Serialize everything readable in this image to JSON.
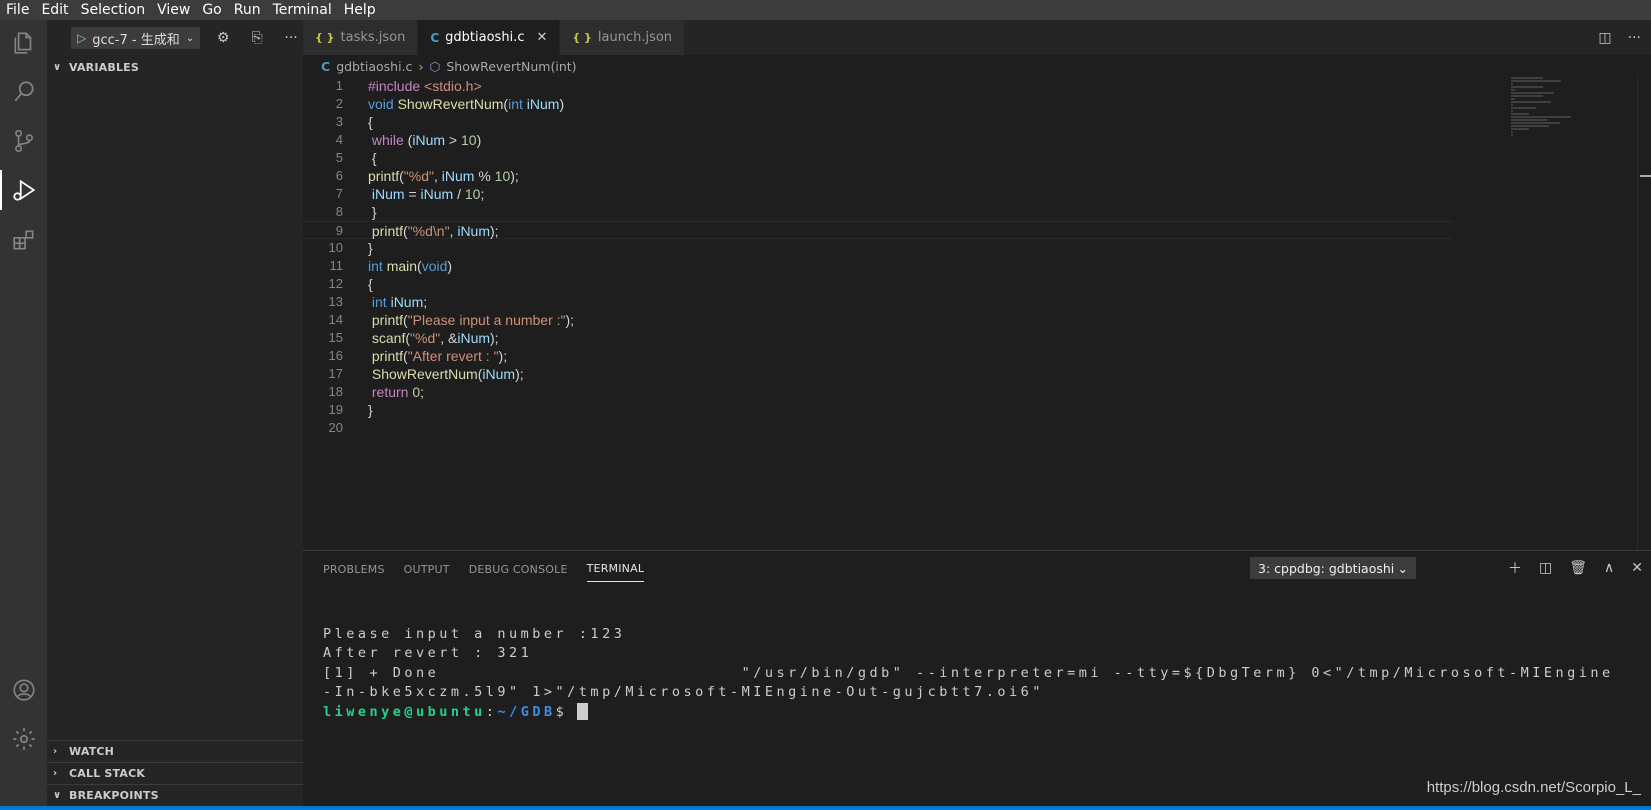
{
  "menubar": {
    "items": [
      "File",
      "Edit",
      "Selection",
      "View",
      "Go",
      "Run",
      "Terminal",
      "Help"
    ]
  },
  "debug": {
    "config_label": "gcc-7 - 生成和",
    "variables_title": "VARIABLES",
    "watch_title": "WATCH",
    "call_stack_title": "CALL STACK",
    "breakpoints_title": "BREAKPOINTS"
  },
  "tabs": [
    {
      "label": "tasks.json",
      "icon": "json-braces-icon"
    },
    {
      "label": "gdbtiaoshi.c",
      "icon": "c-file-icon",
      "active": true
    },
    {
      "label": "launch.json",
      "icon": "json-braces-icon"
    }
  ],
  "breadcrumb": {
    "file": "gdbtiaoshi.c",
    "symbol": "ShowRevertNum(int)"
  },
  "editor": {
    "current_line": 9,
    "line_numbers": [
      "1",
      "2",
      "3",
      "4",
      "5",
      "6",
      "7",
      "8",
      "9",
      "10",
      "11",
      "12",
      "13",
      "14",
      "15",
      "16",
      "17",
      "18",
      "19",
      "20"
    ],
    "lines": [
      "#include <stdio.h>",
      "void ShowRevertNum(int iNum)",
      "{",
      " while (iNum > 10)",
      " {",
      "printf(\"%d\", iNum % 10);",
      " iNum = iNum / 10;",
      " }",
      " printf(\"%d\\n\", iNum);",
      "}",
      "int main(void)",
      "{",
      " int iNum;",
      " printf(\"Please input a number :\");",
      " scanf(\"%d\", &iNum);",
      " printf(\"After revert : \");",
      " ShowRevertNum(iNum);",
      " return 0;",
      "}",
      ""
    ]
  },
  "panel": {
    "tabs": [
      "PROBLEMS",
      "OUTPUT",
      "DEBUG CONSOLE",
      "TERMINAL"
    ],
    "active_tab": "TERMINAL",
    "terminal_select": "3: cppdbg: gdbtiaoshi",
    "terminal_lines": [
      "Please input a number :123",
      "After revert : 321",
      "[1] + Done                          \"/usr/bin/gdb\" --interpreter=mi --tty=${DbgTerm} 0<\"/tmp/Microsoft-MIEngine",
      "-In-bke5xczm.5l9\" 1>\"/tmp/Microsoft-MIEngine-Out-gujcbtt7.oi6\""
    ],
    "prompt_user": "liwenye@ubuntu",
    "prompt_sep": ":",
    "prompt_path": "~/GDB",
    "prompt_symbol": "$"
  },
  "watermark": "https://blog.csdn.net/Scorpio_L_",
  "colors": {
    "accent": "#007acc",
    "terminal_user": "#23d18b",
    "terminal_path": "#3b8eea"
  }
}
